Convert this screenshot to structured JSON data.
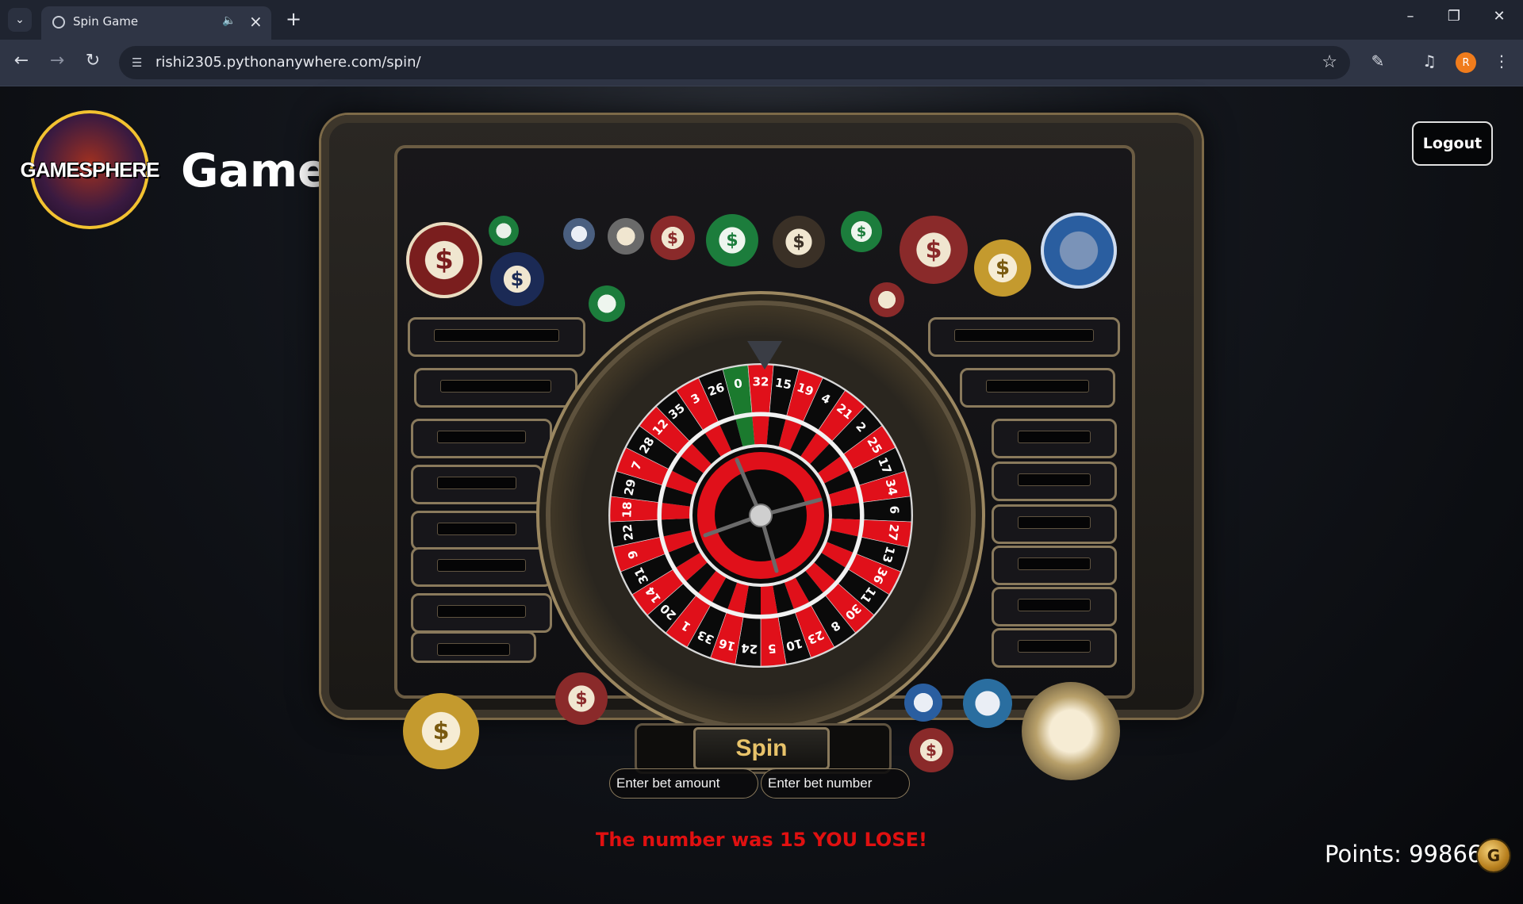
{
  "browser": {
    "tab_title": "Spin Game",
    "url": "rishi2305.pythonanywhere.com/spin/",
    "profile_initial": "R",
    "new_tab_symbol": "+"
  },
  "header": {
    "logo_text": "GAMESPHERE",
    "brand": "GameSphere",
    "logout_label": "Logout"
  },
  "game": {
    "spin_label": "Spin",
    "bet_amount_placeholder": "Enter bet amount",
    "bet_number_placeholder": "Enter bet number",
    "result_message": "The number was 15 YOU LOSE!",
    "points_text": "Points: 99866",
    "coin_symbol": "G",
    "wheel_numbers": [
      "0",
      "32",
      "15",
      "19",
      "4",
      "21",
      "2",
      "25",
      "17",
      "34",
      "6",
      "27",
      "13",
      "36",
      "11",
      "30",
      "8",
      "23",
      "10",
      "5",
      "24",
      "16",
      "33",
      "1",
      "20",
      "14",
      "31",
      "9",
      "22",
      "18",
      "29",
      "7",
      "28",
      "12",
      "35",
      "3",
      "26"
    ],
    "wheel_colors": {
      "red": "#e0101a",
      "black": "#0a0a0a",
      "green": "#1b7a2e"
    }
  }
}
